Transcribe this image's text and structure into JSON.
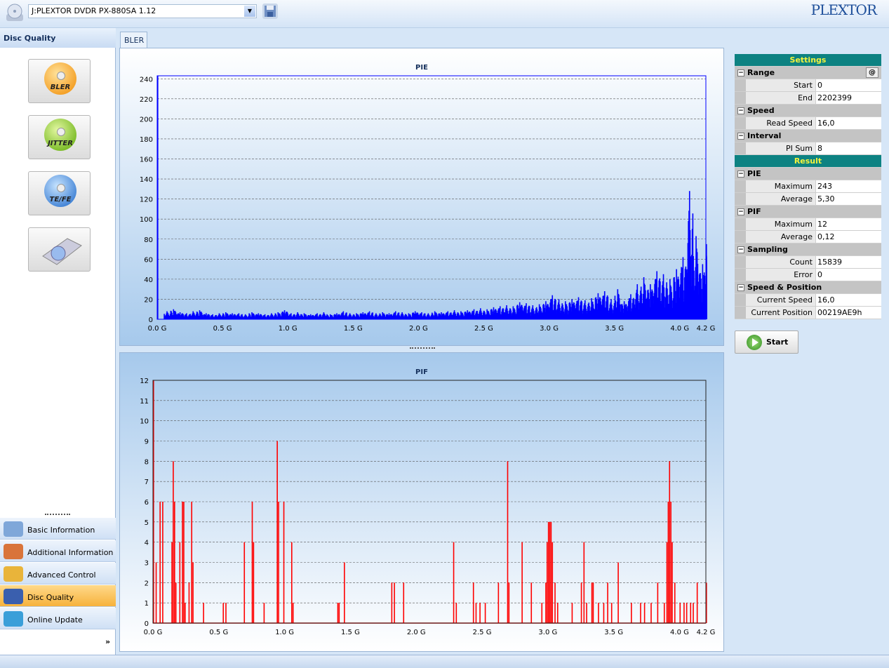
{
  "toolbar": {
    "drive": "J:PLEXTOR DVDR   PX-880SA  1.12",
    "logo": "PLEXTOR"
  },
  "left": {
    "title": "Disc Quality",
    "buttons": [
      "BLER",
      "JITTER",
      "TE/FE",
      ""
    ],
    "nav": [
      {
        "label": "Basic Information",
        "icon": "info-icon"
      },
      {
        "label": "Additional Information",
        "icon": "additional-info-icon"
      },
      {
        "label": "Advanced Control",
        "icon": "gears-icon"
      },
      {
        "label": "Disc Quality",
        "icon": "disc-quality-icon",
        "active": true
      },
      {
        "label": "Online Update",
        "icon": "globe-icon"
      }
    ],
    "more": "»"
  },
  "tabs": [
    "BLER"
  ],
  "colors": {
    "pie": "#0000ff",
    "pif": "#ff0000",
    "header": "#0d8282"
  },
  "settings": {
    "title": "Settings",
    "result_title": "Result",
    "at": "@",
    "groups": [
      {
        "name": "Range",
        "props": [
          [
            "Start",
            "0"
          ],
          [
            "End",
            "2202399"
          ]
        ]
      },
      {
        "name": "Speed",
        "props": [
          [
            "Read Speed",
            "16,0"
          ]
        ]
      },
      {
        "name": "Interval",
        "props": [
          [
            "PI Sum",
            "8"
          ]
        ]
      }
    ],
    "results": [
      {
        "name": "PIE",
        "props": [
          [
            "Maximum",
            "243"
          ],
          [
            "Average",
            "5,30"
          ]
        ]
      },
      {
        "name": "PIF",
        "props": [
          [
            "Maximum",
            "12"
          ],
          [
            "Average",
            "0,12"
          ]
        ]
      },
      {
        "name": "Sampling",
        "props": [
          [
            "Count",
            "15839"
          ],
          [
            "Error",
            "0"
          ]
        ]
      },
      {
        "name": "Speed & Position",
        "props": [
          [
            "Current Speed",
            "16,0"
          ],
          [
            "Current Position",
            "00219AE9h"
          ]
        ]
      }
    ]
  },
  "start": "Start",
  "chart_data": [
    {
      "type": "bar",
      "title": "PIE",
      "xlim": [
        0,
        4.2
      ],
      "ylim": [
        0,
        243
      ],
      "grid": true,
      "xticks": [
        "0.0 G",
        "0.5 G",
        "1.0 G",
        "1.5 G",
        "2.0 G",
        "2.5 G",
        "3.0 G",
        "3.5 G",
        "4.0 G",
        "4.2 G"
      ],
      "yticks": [
        0,
        20,
        40,
        60,
        80,
        100,
        120,
        140,
        160,
        180,
        200,
        220,
        240
      ],
      "x_step": 0.05,
      "values": [
        243,
        8,
        10,
        7,
        6,
        8,
        9,
        6,
        5,
        6,
        7,
        6,
        6,
        5,
        7,
        6,
        5,
        6,
        7,
        9,
        6,
        7,
        6,
        5,
        6,
        7,
        5,
        6,
        8,
        6,
        6,
        7,
        8,
        6,
        7,
        6,
        8,
        7,
        6,
        8,
        7,
        6,
        8,
        7,
        8,
        9,
        8,
        9,
        10,
        11,
        10,
        12,
        13,
        14,
        13,
        17,
        16,
        14,
        15,
        18,
        24,
        20,
        18,
        20,
        22,
        19,
        21,
        26,
        28,
        20,
        30,
        18,
        25,
        35,
        42,
        35,
        48,
        45,
        40,
        50,
        62,
        128,
        83,
        55,
        75
      ]
    },
    {
      "type": "bar",
      "title": "PIF",
      "xlim": [
        0,
        4.2
      ],
      "ylim": [
        0,
        12
      ],
      "grid": true,
      "xticks": [
        "0.0 G",
        "0.5 G",
        "1.0 G",
        "1.5 G",
        "2.0 G",
        "2.5 G",
        "3.0 G",
        "3.5 G",
        "4.0 G",
        "4.2 G"
      ],
      "yticks": [
        0,
        1,
        2,
        3,
        4,
        5,
        6,
        7,
        8,
        9,
        10,
        11,
        12
      ],
      "points": [
        [
          0,
          12
        ],
        [
          0.02,
          3
        ],
        [
          0.05,
          6
        ],
        [
          0.07,
          6
        ],
        [
          0.14,
          4
        ],
        [
          0.15,
          8
        ],
        [
          0.16,
          6
        ],
        [
          0.17,
          2
        ],
        [
          0.2,
          4
        ],
        [
          0.22,
          6
        ],
        [
          0.23,
          6
        ],
        [
          0.24,
          1
        ],
        [
          0.27,
          2
        ],
        [
          0.29,
          6
        ],
        [
          0.3,
          3
        ],
        [
          0.38,
          1
        ],
        [
          0.53,
          1
        ],
        [
          0.55,
          1
        ],
        [
          0.69,
          4
        ],
        [
          0.75,
          6
        ],
        [
          0.76,
          4
        ],
        [
          0.84,
          1
        ],
        [
          0.94,
          9
        ],
        [
          0.95,
          6
        ],
        [
          0.99,
          6
        ],
        [
          1.05,
          4
        ],
        [
          1.06,
          1
        ],
        [
          1.4,
          1
        ],
        [
          1.41,
          1
        ],
        [
          1.45,
          3
        ],
        [
          1.81,
          2
        ],
        [
          1.83,
          2
        ],
        [
          1.9,
          2
        ],
        [
          2.28,
          4
        ],
        [
          2.3,
          1
        ],
        [
          2.43,
          2
        ],
        [
          2.45,
          1
        ],
        [
          2.48,
          1
        ],
        [
          2.52,
          1
        ],
        [
          2.62,
          2
        ],
        [
          2.69,
          8
        ],
        [
          2.7,
          2
        ],
        [
          2.8,
          4
        ],
        [
          2.87,
          2
        ],
        [
          2.95,
          1
        ],
        [
          2.98,
          2
        ],
        [
          2.99,
          4
        ],
        [
          3.0,
          5
        ],
        [
          3.01,
          5
        ],
        [
          3.02,
          5
        ],
        [
          3.03,
          4
        ],
        [
          3.05,
          2
        ],
        [
          3.07,
          1
        ],
        [
          3.18,
          1
        ],
        [
          3.25,
          2
        ],
        [
          3.27,
          4
        ],
        [
          3.29,
          1
        ],
        [
          3.33,
          2
        ],
        [
          3.34,
          2
        ],
        [
          3.38,
          1
        ],
        [
          3.42,
          1
        ],
        [
          3.45,
          2
        ],
        [
          3.48,
          1
        ],
        [
          3.53,
          3
        ],
        [
          3.63,
          1
        ],
        [
          3.7,
          1
        ],
        [
          3.73,
          1
        ],
        [
          3.78,
          1
        ],
        [
          3.83,
          2
        ],
        [
          3.88,
          1
        ],
        [
          3.9,
          4
        ],
        [
          3.91,
          6
        ],
        [
          3.92,
          8
        ],
        [
          3.93,
          6
        ],
        [
          3.94,
          4
        ],
        [
          3.96,
          2
        ],
        [
          4.0,
          1
        ],
        [
          4.03,
          1
        ],
        [
          4.05,
          1
        ],
        [
          4.08,
          1
        ],
        [
          4.1,
          1
        ],
        [
          4.13,
          2
        ],
        [
          4.2,
          2
        ]
      ]
    }
  ]
}
